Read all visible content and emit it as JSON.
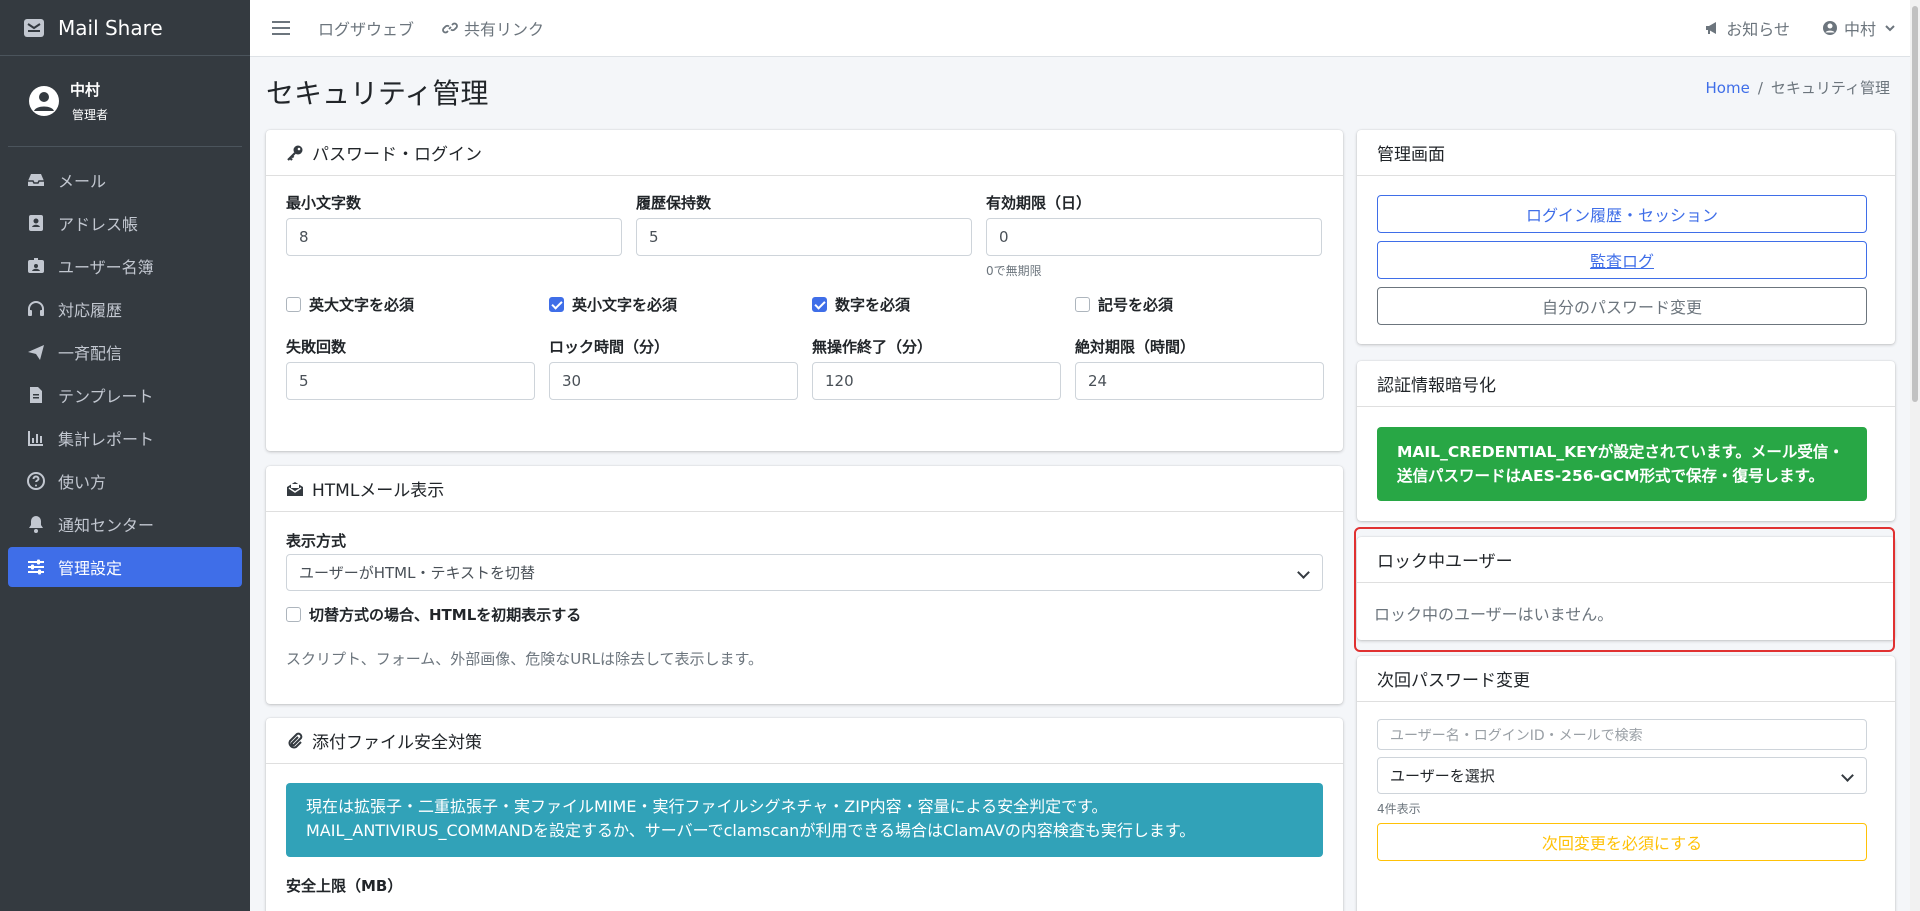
{
  "brand": {
    "name": "Mail Share"
  },
  "user": {
    "name": "中村",
    "role": "管理者"
  },
  "sidebar": {
    "items": [
      {
        "label": "メール"
      },
      {
        "label": "アドレス帳"
      },
      {
        "label": "ユーザー名簿"
      },
      {
        "label": "対応履歴"
      },
      {
        "label": "一斉配信"
      },
      {
        "label": "テンプレート"
      },
      {
        "label": "集計レポート"
      },
      {
        "label": "使い方"
      },
      {
        "label": "通知センター"
      },
      {
        "label": "管理設定"
      }
    ]
  },
  "topbar": {
    "links": [
      "ログザウェブ",
      "共有リンク"
    ],
    "notifications": "お知らせ",
    "user": "中村"
  },
  "page": {
    "title": "セキュリティ管理",
    "breadcrumb": {
      "home": "Home",
      "sep": "/",
      "current": "セキュリティ管理"
    }
  },
  "password_card": {
    "title": "パスワード・ログイン",
    "min_length_label": "最小文字数",
    "min_length": "8",
    "history_label": "履歴保持数",
    "history": "5",
    "expiry_label": "有効期限（日）",
    "expiry": "0",
    "expiry_hint": "0で無期限",
    "checkboxes": [
      {
        "label": "英大文字を必須",
        "checked": false
      },
      {
        "label": "英小文字を必須",
        "checked": true
      },
      {
        "label": "数字を必須",
        "checked": true
      },
      {
        "label": "記号を必須",
        "checked": false
      }
    ],
    "fail_count_label": "失敗回数",
    "fail_count": "5",
    "lock_time_label": "ロック時間（分）",
    "lock_time": "30",
    "idle_label": "無操作終了（分）",
    "idle": "120",
    "absolute_label": "絶対期限（時間）",
    "absolute": "24"
  },
  "html_card": {
    "title": "HTMLメール表示",
    "mode_label": "表示方式",
    "mode_value": "ユーザーがHTML・テキストを切替",
    "default_html_label": "切替方式の場合、HTMLを初期表示する",
    "note": "スクリプト、フォーム、外部画像、危険なURLは除去して表示します。"
  },
  "attach_card": {
    "title": "添付ファイル安全対策",
    "info_line1": "現在は拡張子・二重拡張子・実ファイルMIME・実行ファイルシグネチャ・ZIP内容・容量による安全判定です。",
    "info_line2": "MAIL_ANTIVIRUS_COMMANDを設定するか、サーバーでclamscanが利用できる場合はClamAVの内容検査も実行します。",
    "limit_label": "安全上限（MB）"
  },
  "admin_card": {
    "title": "管理画面",
    "login_history": "ログイン履歴・セッション",
    "audit_log": "監査ログ",
    "change_password": "自分のパスワード変更"
  },
  "crypto_card": {
    "title": "認証情報暗号化",
    "message": "MAIL_CREDENTIAL_KEYが設定されています。メール受信・送信パスワードはAES-256-GCM形式で保存・復号します。"
  },
  "locked_card": {
    "title": "ロック中ユーザー",
    "empty": "ロック中のユーザーはいません。"
  },
  "next_pw_card": {
    "title": "次回パスワード変更",
    "search_placeholder": "ユーザー名・ログインID・メールで検索",
    "select_value": "ユーザーを選択",
    "count": "4件表示",
    "require_button": "次回変更を必須にする"
  },
  "colors": {
    "accent": "#3f6ee8",
    "sidebar_bg": "#343a40",
    "success": "#28a745",
    "info": "#31a2b8",
    "warning": "#ffc107",
    "highlight": "#e03131"
  }
}
